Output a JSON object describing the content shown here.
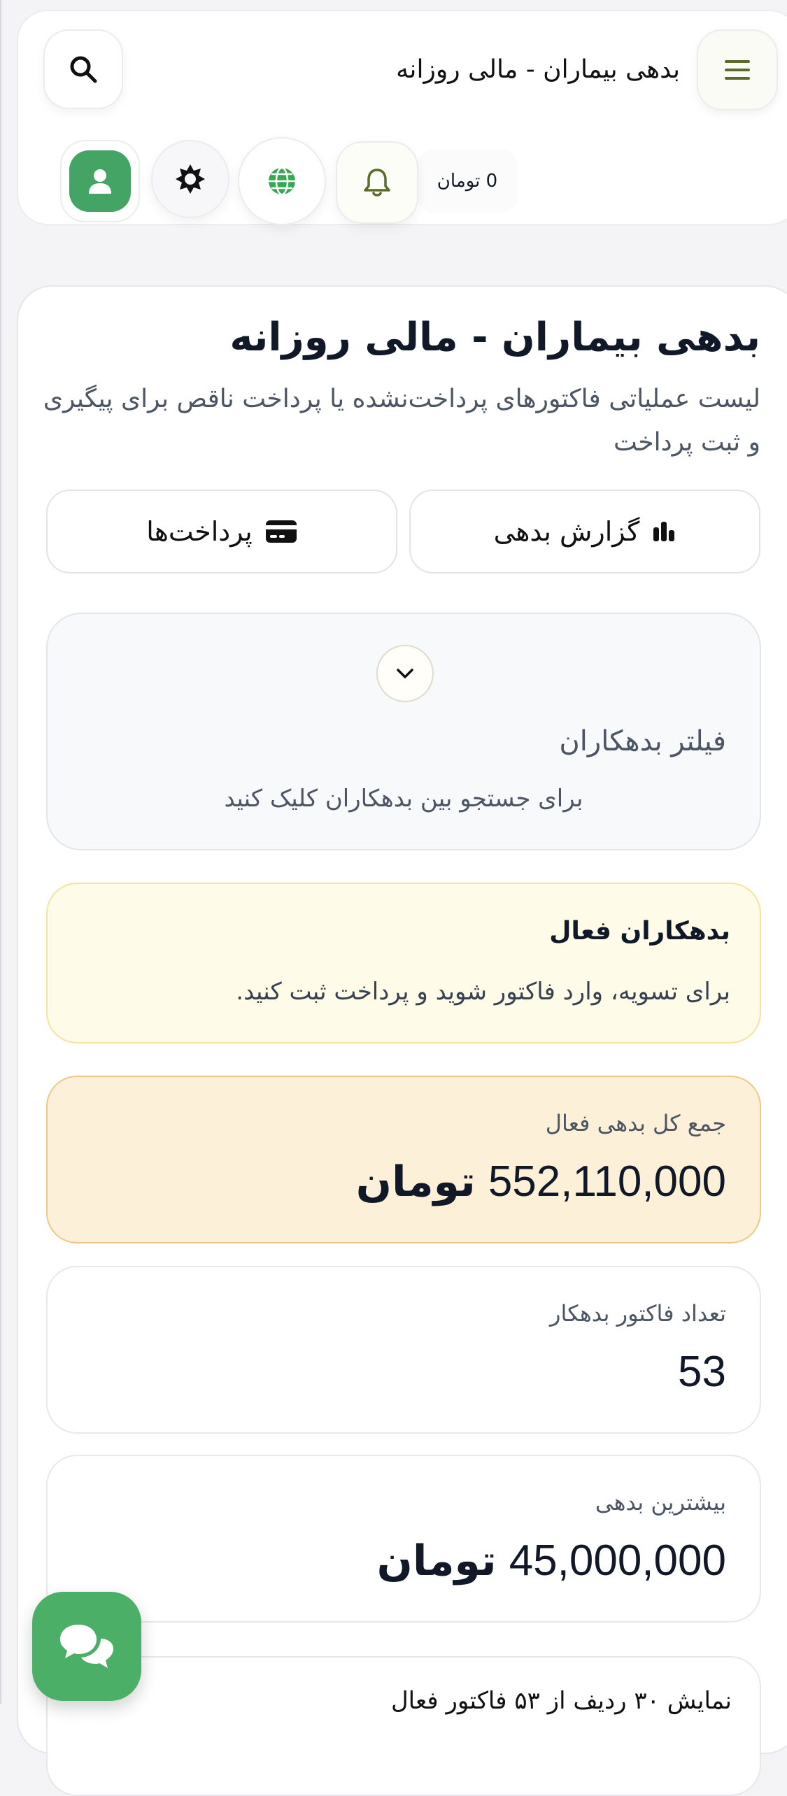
{
  "header": {
    "title": "بدهی بیماران - مالی روزانه",
    "balance": "0 تومان"
  },
  "icons": {
    "menu": "menu-icon",
    "search": "search-icon",
    "bell": "bell-icon",
    "globe": "globe-icon",
    "theme": "sun-icon",
    "profile": "user-icon",
    "chart": "bar-chart-icon",
    "card": "credit-card-icon",
    "chevron": "chevron-down-icon",
    "chat": "chat-icon"
  },
  "colors": {
    "accent_green": "#43a466",
    "olive": "#5b6b2a",
    "notice_bg": "#fefbe8",
    "total_bg": "#fdf0d8"
  },
  "page": {
    "title": "بدهی بیماران - مالی روزانه",
    "subtitle": "لیست عملیاتی فاکتورهای پرداخت‌نشده یا پرداخت ناقص برای پیگیری و ثبت پرداخت"
  },
  "actions": {
    "report": "گزارش بدهی",
    "payments": "پرداخت‌ها"
  },
  "filter": {
    "title": "فیلتر بدهکاران",
    "hint": "برای جستجو بین بدهکاران کلیک کنید"
  },
  "notice": {
    "title": "بدهکاران فعال",
    "text": "برای تسویه، وارد فاکتور شوید و پرداخت ثبت کنید."
  },
  "stats": {
    "total": {
      "label": "جمع کل بدهی فعال",
      "value": "552,110,000",
      "unit": "تومان"
    },
    "count": {
      "label": "تعداد فاکتور بدهکار",
      "value": "53"
    },
    "max": {
      "label": "بیشترین بدهی",
      "value": "45,000,000",
      "unit": "تومان"
    }
  },
  "partial": {
    "text": "نمایش ۳۰ ردیف از ۵۳ فاکتور فعال"
  }
}
